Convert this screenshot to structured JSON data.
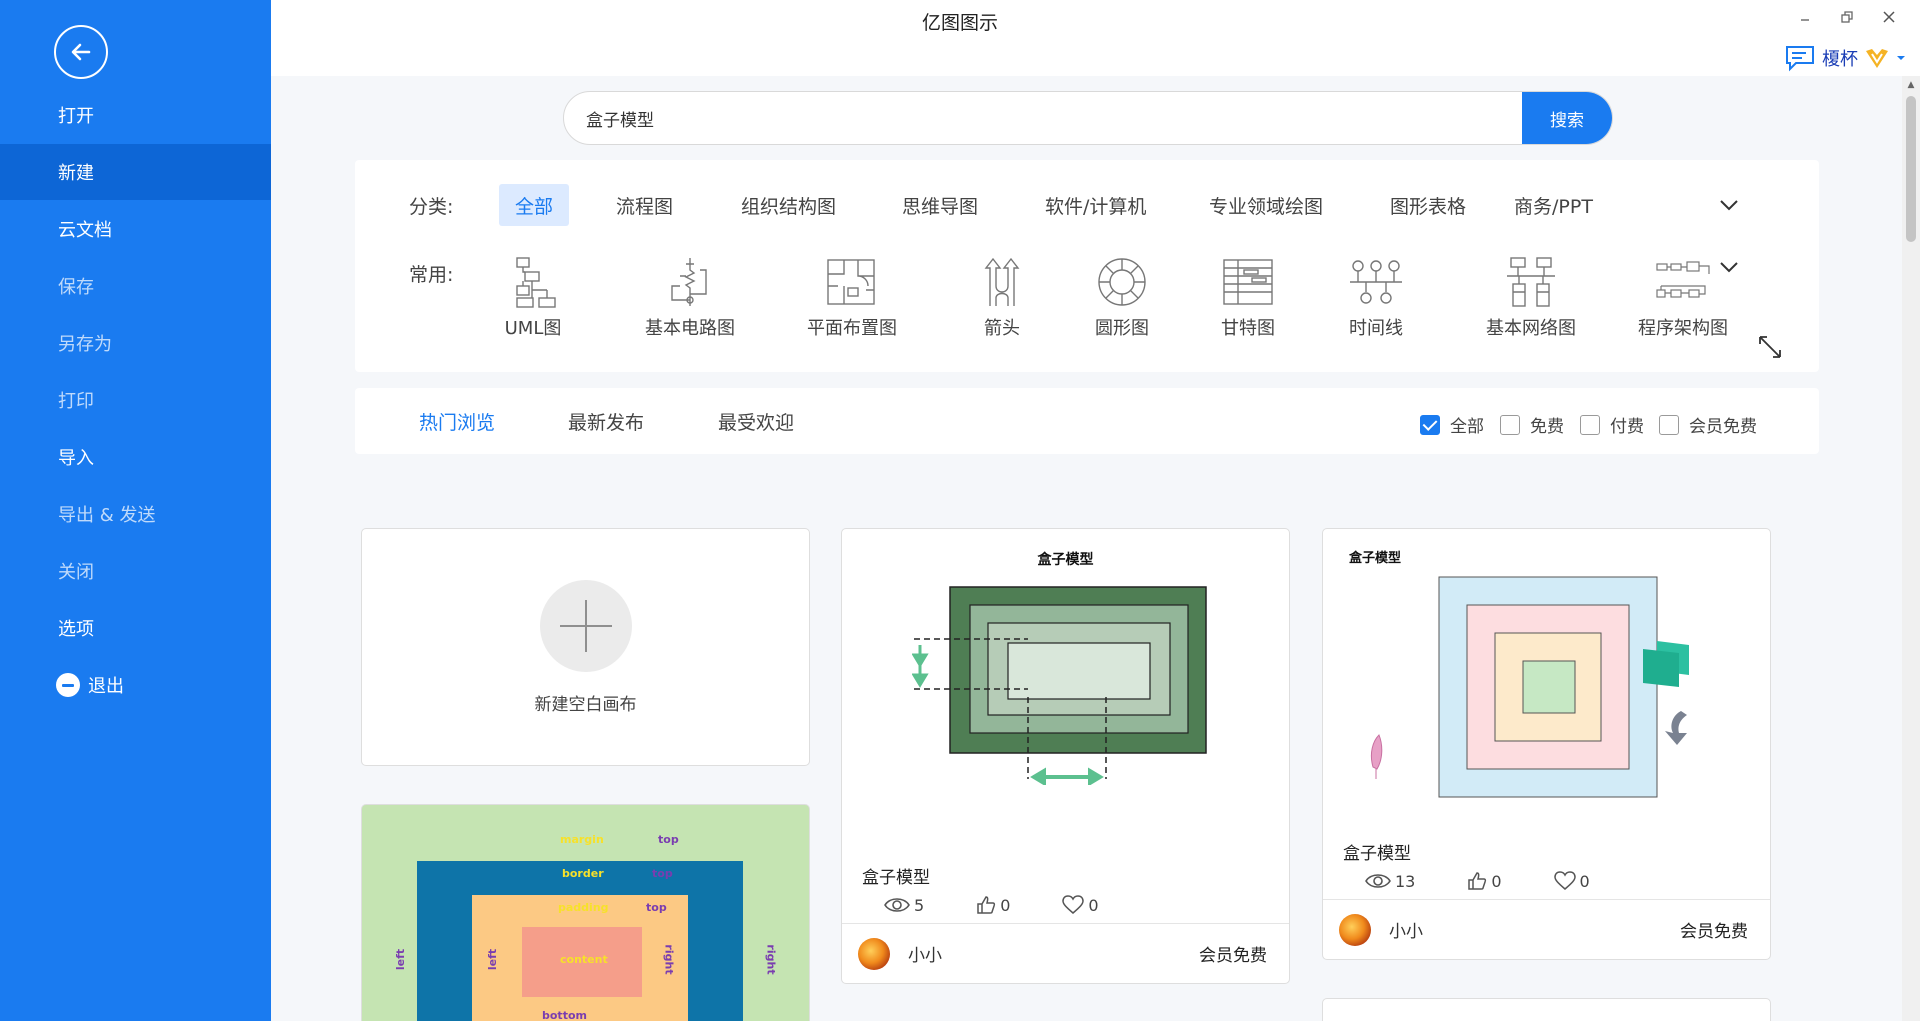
{
  "window": {
    "title": "亿图图示",
    "user_name": "榎杯"
  },
  "sidebar": {
    "items": [
      {
        "label": "打开"
      },
      {
        "label": "新建"
      },
      {
        "label": "云文档"
      },
      {
        "label": "保存"
      },
      {
        "label": "另存为"
      },
      {
        "label": "打印"
      },
      {
        "label": "导入"
      },
      {
        "label": "导出 & 发送"
      },
      {
        "label": "关闭"
      },
      {
        "label": "选项"
      },
      {
        "label": "退出"
      }
    ]
  },
  "search": {
    "value": "盒子模型",
    "button_label": "搜索"
  },
  "categories": {
    "label": "分类:",
    "tabs": [
      "全部",
      "流程图",
      "组织结构图",
      "思维导图",
      "软件/计算机",
      "专业领域绘图",
      "图形表格",
      "商务/PPT"
    ]
  },
  "common": {
    "label": "常用:",
    "items": [
      "UML图",
      "基本电路图",
      "平面布置图",
      "箭头",
      "圆形图",
      "甘特图",
      "时间线",
      "基本网络图",
      "程序架构图"
    ]
  },
  "sort": {
    "tabs": [
      "热门浏览",
      "最新发布",
      "最受欢迎"
    ]
  },
  "filters": [
    {
      "label": "全部",
      "checked": true
    },
    {
      "label": "免费",
      "checked": false
    },
    {
      "label": "付费",
      "checked": false
    },
    {
      "label": "会员免费",
      "checked": false
    }
  ],
  "new_card": {
    "label": "新建空白画布"
  },
  "templates": [
    {
      "title": "盒子模型",
      "preview_title": "盒子模型",
      "views": "5",
      "likes": "0",
      "favorites": "0",
      "author": "小小",
      "price": "会员免费"
    },
    {
      "title": "盒子模型",
      "preview_title": "盒子模型",
      "views": "13",
      "likes": "0",
      "favorites": "0",
      "author": "小小",
      "price": "会员免费"
    },
    {
      "preview_labels": {
        "margin": "margin",
        "margin_side": "top",
        "border": "border",
        "border_side": "top",
        "padding": "padding",
        "padding_side": "top",
        "content": "content",
        "left": "left",
        "right": "right",
        "bottom": "bottom"
      }
    }
  ],
  "colors": {
    "accent": "#1a7bf0",
    "sidebar": "#1a7bf0",
    "sidebar_active": "#0d66d6"
  }
}
